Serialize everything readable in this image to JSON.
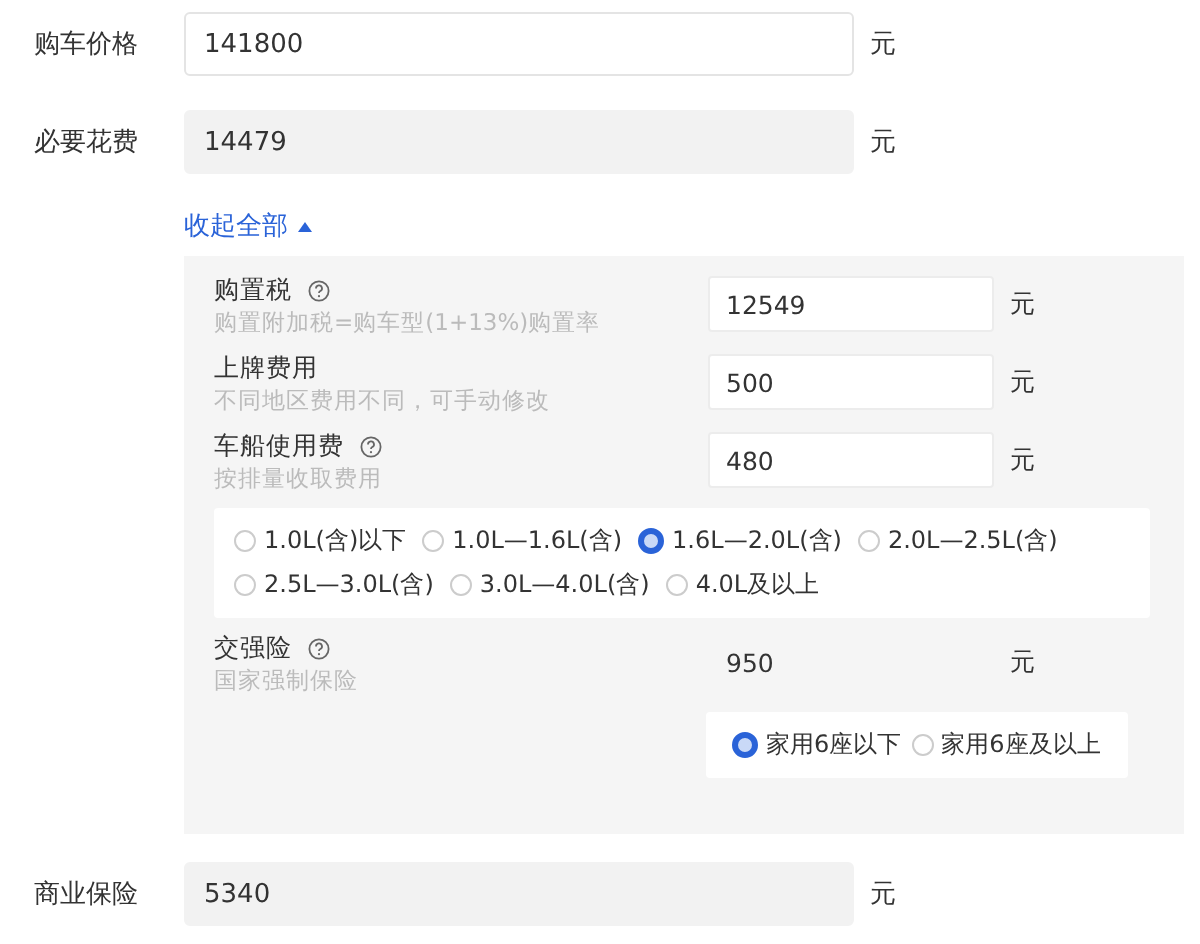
{
  "fields": [
    {
      "label": "购车价格",
      "value": "141800",
      "unit": "元",
      "editable": true
    },
    {
      "label": "必要花费",
      "value": "14479",
      "unit": "元",
      "editable": false
    }
  ],
  "toggle": {
    "label": "收起全部",
    "expanded": true
  },
  "details": [
    {
      "label": "购置税",
      "help": true,
      "note": "购置附加税=购车型(1+13%)购置率",
      "value": "12549",
      "unit": "元",
      "editable": true
    },
    {
      "label": "上牌费用",
      "help": false,
      "note": "不同地区费用不同，可手动修改",
      "value": "500",
      "unit": "元",
      "editable": true
    },
    {
      "label": "车船使用费",
      "help": true,
      "note": "按排量收取费用",
      "value": "480",
      "unit": "元",
      "editable": true,
      "options_wide": true,
      "options": [
        {
          "label": "1.0L(含)以下",
          "selected": false
        },
        {
          "label": "1.0L—1.6L(含)",
          "selected": false
        },
        {
          "label": "1.6L—2.0L(含)",
          "selected": true
        },
        {
          "label": "2.0L—2.5L(含)",
          "selected": false
        },
        {
          "label": "2.5L—3.0L(含)",
          "selected": false
        },
        {
          "label": "3.0L—4.0L(含)",
          "selected": false
        },
        {
          "label": "4.0L及以上",
          "selected": false
        }
      ]
    },
    {
      "label": "交强险",
      "help": true,
      "note": "国家强制保险",
      "value": "950",
      "unit": "元",
      "editable": false,
      "options_wide": false,
      "options": [
        {
          "label": "家用6座以下",
          "selected": true
        },
        {
          "label": "家用6座及以上",
          "selected": false
        }
      ]
    }
  ],
  "after": [
    {
      "label": "商业保险",
      "value": "5340",
      "unit": "元",
      "editable": false
    }
  ]
}
